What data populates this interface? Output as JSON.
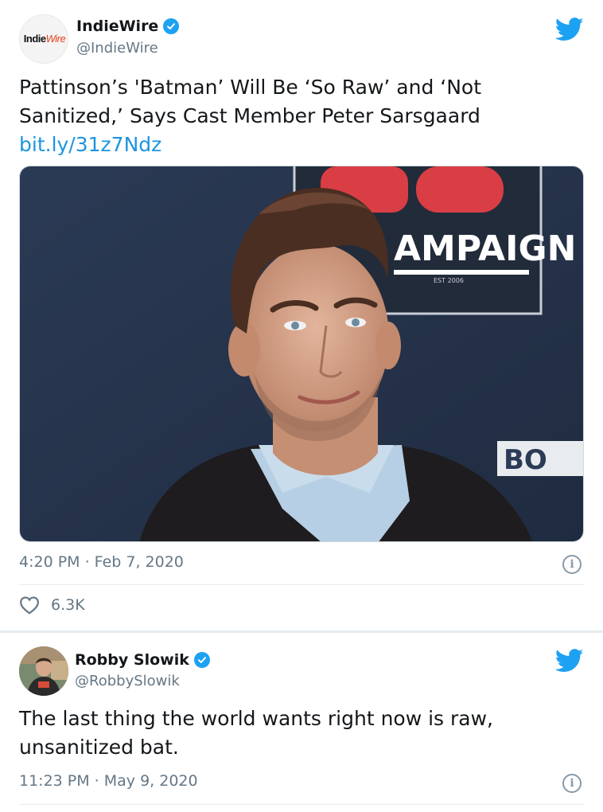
{
  "tweet1": {
    "author_name": "IndieWire",
    "author_handle": "@IndieWire",
    "avatar_logo_bold": "Indie",
    "avatar_logo_light": "Wire",
    "text_line1": "Pattinson’s 'Batman’ Will Be ‘So Raw’ and ‘Not",
    "text_line2": "Sanitized,’ Says Cast Member Peter Sarsgaard",
    "link": "bit.ly/31z7Ndz",
    "photo_sign_text": "AMPAIGN",
    "photo_sign_sub": "EST 2006",
    "photo_sign_side": "BO",
    "timestamp": "4:20 PM · Feb 7, 2020",
    "likes": "6.3K"
  },
  "tweet2": {
    "author_name": "Robby Slowik",
    "author_handle": "@RobbySlowik",
    "text_line1": "The last thing the world wants right now is raw,",
    "text_line2": "unsanitized bat.",
    "timestamp": "11:23 PM · May 9, 2020"
  },
  "icons": {
    "info_glyph": "i"
  },
  "colors": {
    "twitter_blue": "#1da1f2",
    "link_blue": "#1b95e0",
    "secondary_text": "#657786"
  }
}
